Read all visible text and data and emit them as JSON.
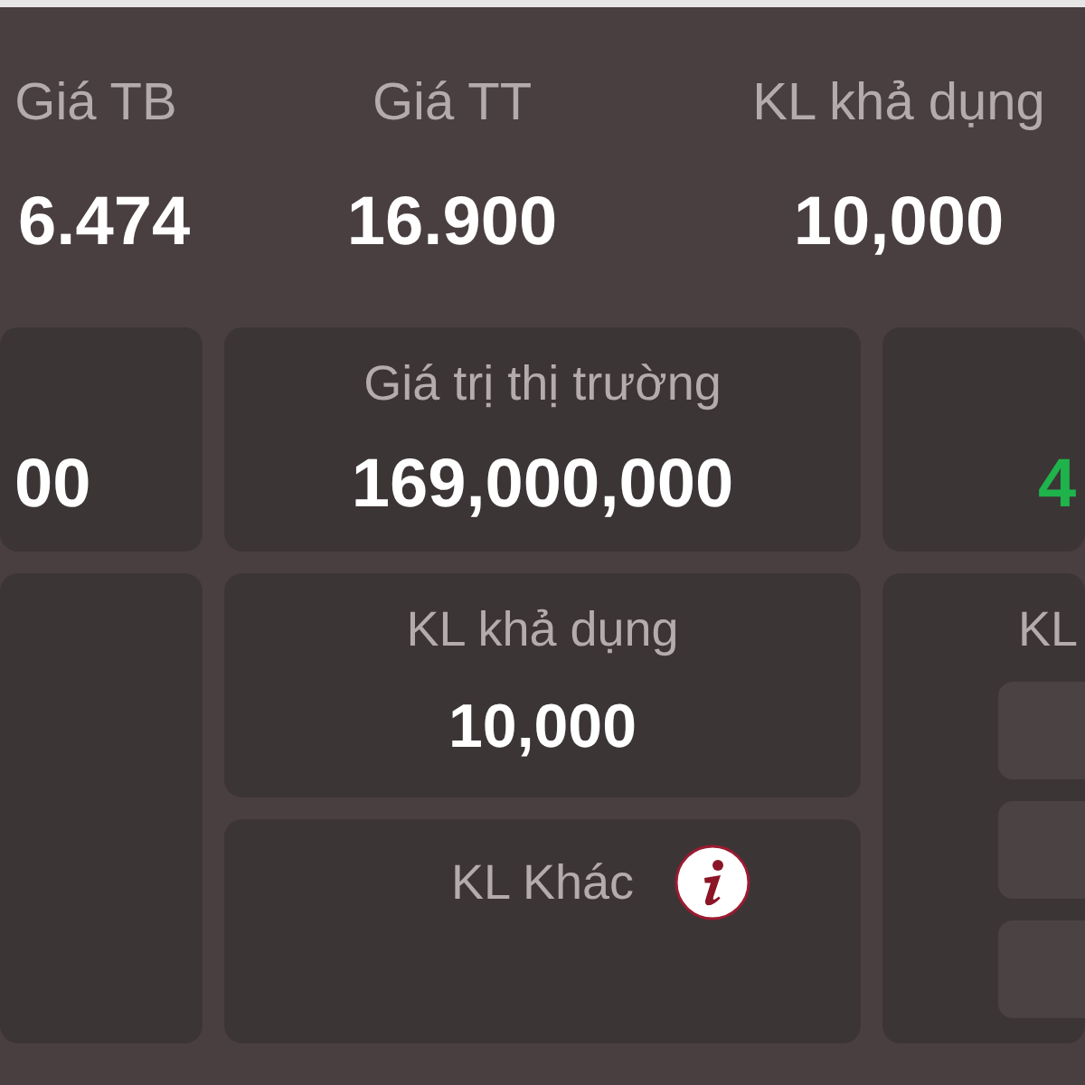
{
  "header_stats": [
    {
      "label": "Giá TB",
      "value": "6.474"
    },
    {
      "label": "Giá TT",
      "value": "16.900"
    },
    {
      "label": "KL khả dụng",
      "value": "10,000"
    }
  ],
  "card_columns": [
    {
      "cards": [
        {
          "kind": "stat",
          "value": "00",
          "color": "#ffffff"
        },
        {
          "kind": "blank"
        }
      ]
    },
    {
      "cards": [
        {
          "kind": "stat",
          "label": "Giá trị thị trường",
          "value": "169,000,000",
          "color": "#ffffff"
        },
        {
          "kind": "stat",
          "label": "KL khả dụng",
          "value": "10,000",
          "color": "#ffffff"
        },
        {
          "kind": "stat",
          "label": "KL Khác",
          "info": true
        }
      ]
    },
    {
      "cards": [
        {
          "kind": "stat",
          "value": "4",
          "color": "#1fb34c"
        },
        {
          "kind": "breakdown",
          "label": "KL",
          "rows": [
            {
              "kind": "blank"
            },
            {
              "kind": "blank"
            },
            {
              "kind": "blank"
            }
          ]
        }
      ]
    }
  ]
}
